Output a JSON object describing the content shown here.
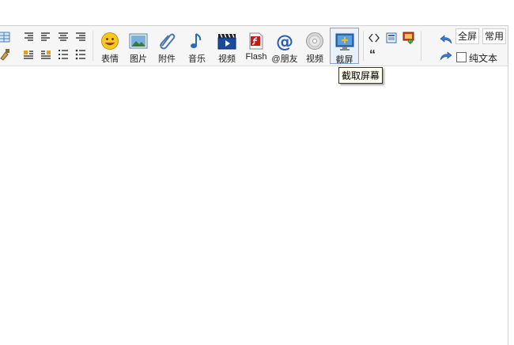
{
  "toolbar": {
    "tools": [
      {
        "label": "表情",
        "icon": "smiley-icon"
      },
      {
        "label": "图片",
        "icon": "image-icon"
      },
      {
        "label": "附件",
        "icon": "paperclip-icon"
      },
      {
        "label": "音乐",
        "icon": "music-note-icon"
      },
      {
        "label": "视频",
        "icon": "video-clapper-icon"
      },
      {
        "label": "Flash",
        "icon": "flash-icon"
      },
      {
        "label": "@朋友",
        "icon": "at-sign-icon"
      },
      {
        "label": "视频",
        "icon": "video-disc-icon"
      },
      {
        "label": "截屏",
        "icon": "screenshot-icon"
      }
    ],
    "tooltip": "截取屏幕",
    "fullscreen": "全屏",
    "common": "常用",
    "plaintext": "纯文本",
    "quote_glyph": "“"
  },
  "colors": {
    "toolbar_bg": "#f6f6f6",
    "active_border": "#7aa7cf",
    "accent_blue": "#2f6fb8"
  }
}
